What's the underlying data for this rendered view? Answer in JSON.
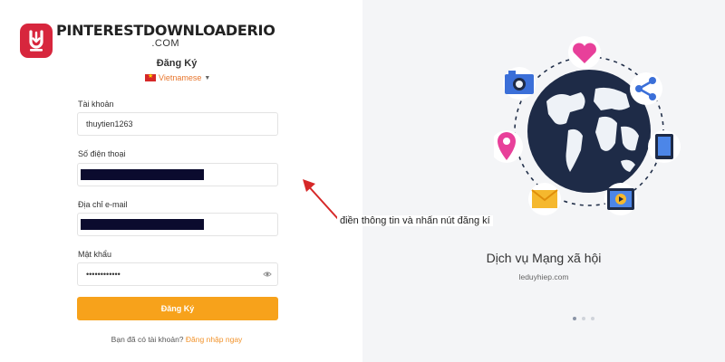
{
  "brand": {
    "name_part1": "PINTEREST",
    "name_part2": "DOWNLOADERIO",
    "domain": ".COM"
  },
  "form": {
    "title": "Đăng Ký",
    "language": "Vietnamese",
    "fields": {
      "username": {
        "label": "Tài khoản",
        "value": "thuytien1263"
      },
      "phone": {
        "label": "Số điện thoại",
        "value": ""
      },
      "email": {
        "label": "Địa chỉ e-mail",
        "value": ""
      },
      "password": {
        "label": "Mật khẩu",
        "value": "••••••••••••"
      }
    },
    "submit_label": "Đăng Ký",
    "have_account_text": "Bạn đã có tài khoản?",
    "login_link": "Đăng nhập ngay"
  },
  "annotation": {
    "text": "điền thông tin và nhấn nút đăng kí",
    "color": "#d62828"
  },
  "promo": {
    "title": "Dịch vụ Mạng xã hội",
    "subtitle": "leduyhiep.com",
    "carousel_total": 3,
    "carousel_active": 1,
    "icons": [
      "heart-icon",
      "share-icon",
      "tablet-icon",
      "video-icon",
      "mail-icon",
      "location-pin-icon",
      "camera-icon",
      "globe-icon"
    ]
  },
  "colors": {
    "accent": "#f7a21b",
    "brand_red": "#d7263d",
    "link": "#f2932b"
  }
}
